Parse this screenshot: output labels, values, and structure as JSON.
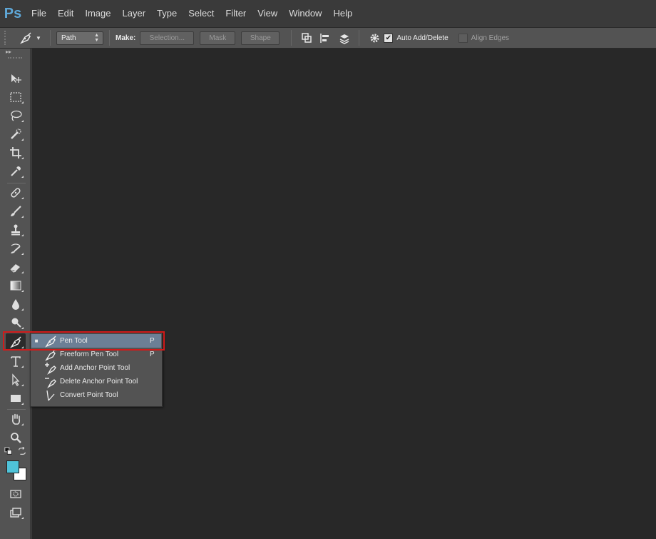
{
  "app": {
    "logo": "Ps"
  },
  "menu": [
    "File",
    "Edit",
    "Image",
    "Layer",
    "Type",
    "Select",
    "Filter",
    "View",
    "Window",
    "Help"
  ],
  "options": {
    "mode_select": "Path",
    "make_label": "Make:",
    "selection_btn": "Selection...",
    "mask_btn": "Mask",
    "shape_btn": "Shape",
    "auto_add_delete": "Auto Add/Delete",
    "auto_add_delete_checked": true,
    "align_edges": "Align Edges",
    "align_edges_checked": false
  },
  "toolbar": {
    "collapse_glyph": "▸▸"
  },
  "flyout": {
    "items": [
      {
        "bullet": "■",
        "name": "Pen Tool",
        "key": "P",
        "selected": true
      },
      {
        "bullet": "",
        "name": "Freeform Pen Tool",
        "key": "P",
        "selected": false
      },
      {
        "bullet": "",
        "name": "Add Anchor Point Tool",
        "key": "",
        "selected": false
      },
      {
        "bullet": "",
        "name": "Delete Anchor Point Tool",
        "key": "",
        "selected": false
      },
      {
        "bullet": "",
        "name": "Convert Point Tool",
        "key": "",
        "selected": false
      }
    ]
  },
  "colors": {
    "foreground": "#4fc3d9",
    "background": "#ffffff",
    "highlight": "#d11a1a"
  }
}
